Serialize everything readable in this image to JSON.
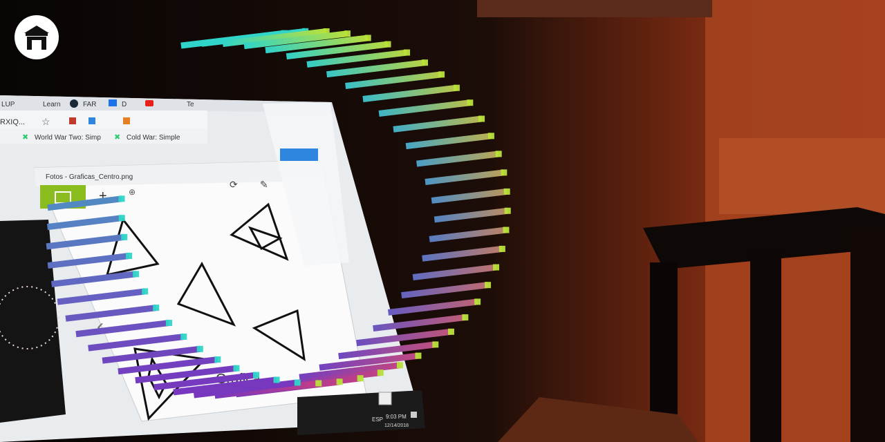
{
  "app": {
    "home_icon": "home-icon",
    "home_label": "Home"
  },
  "laptop_screen": {
    "browser_tabs": [
      "LUP",
      "Learn",
      "FAR",
      "D",
      "",
      "Te"
    ],
    "address_fragment": "RXIQ...",
    "bookmarks": [
      "World War Two: Simp",
      "Cold War: Simple"
    ],
    "photos_window": {
      "title": "Fotos - Graficas_Centro.png",
      "caption_fragment": "Grafica"
    },
    "taskbar": {
      "language": "ESP",
      "time": "9:03 PM",
      "date": "12/14/2018"
    }
  },
  "hologram": {
    "type": "3d-bar-ring",
    "color_top": "#2fd6c8",
    "color_bottom": "#7b2fbe",
    "color_right_top": "#b8e23a",
    "color_right_bottom": "#c2358a"
  }
}
